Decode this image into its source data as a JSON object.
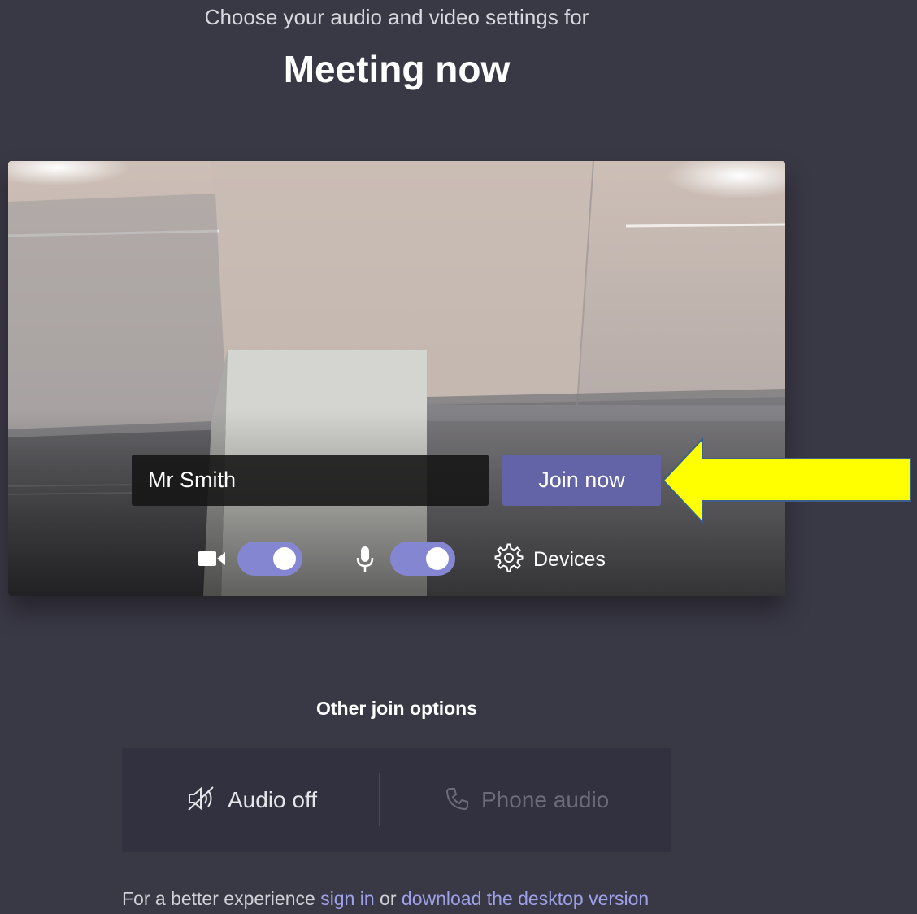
{
  "header": {
    "subtitle": "Choose your audio and video settings for",
    "title": "Meeting now"
  },
  "prejoin": {
    "name_value": "Mr Smith",
    "join_label": "Join now",
    "camera": {
      "icon": "camera-icon",
      "enabled": true
    },
    "microphone": {
      "icon": "microphone-icon",
      "enabled": true
    },
    "devices_label": "Devices",
    "devices_icon": "gear-icon"
  },
  "other_options": {
    "heading": "Other join options",
    "audio_off_label": "Audio off",
    "audio_off_icon": "speaker-off-icon",
    "phone_audio_label": "Phone audio",
    "phone_audio_icon": "phone-icon"
  },
  "footer": {
    "prefix": "For a better experience ",
    "sign_in": "sign in",
    "middle": " or ",
    "download": "download the desktop version"
  },
  "colors": {
    "background": "#393845",
    "accent": "#6264a7",
    "toggle_on": "#8486d2",
    "link": "#9ea1e8",
    "annotation_arrow": "#ffff00"
  }
}
